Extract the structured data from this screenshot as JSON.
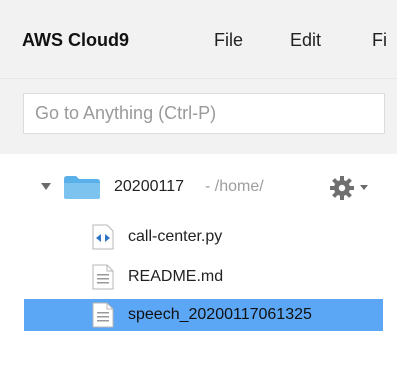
{
  "menubar": {
    "brand": "AWS Cloud9",
    "items": [
      "File",
      "Edit",
      "Fi"
    ]
  },
  "goto": {
    "placeholder": "Go to Anything (Ctrl-P)"
  },
  "tree": {
    "root": {
      "name": "20200117",
      "path": " - /home/",
      "icon": "folder-icon"
    },
    "files": [
      {
        "label": "call-center.py",
        "icon": "python-file-icon",
        "selected": false
      },
      {
        "label": "README.md",
        "icon": "document-icon",
        "selected": false
      },
      {
        "label": "speech_20200117061325",
        "icon": "document-icon",
        "selected": true
      }
    ]
  },
  "colors": {
    "selection": "#5ba6f5",
    "folder": "#5ab0e8",
    "menubar_bg": "#f2f2f2"
  }
}
